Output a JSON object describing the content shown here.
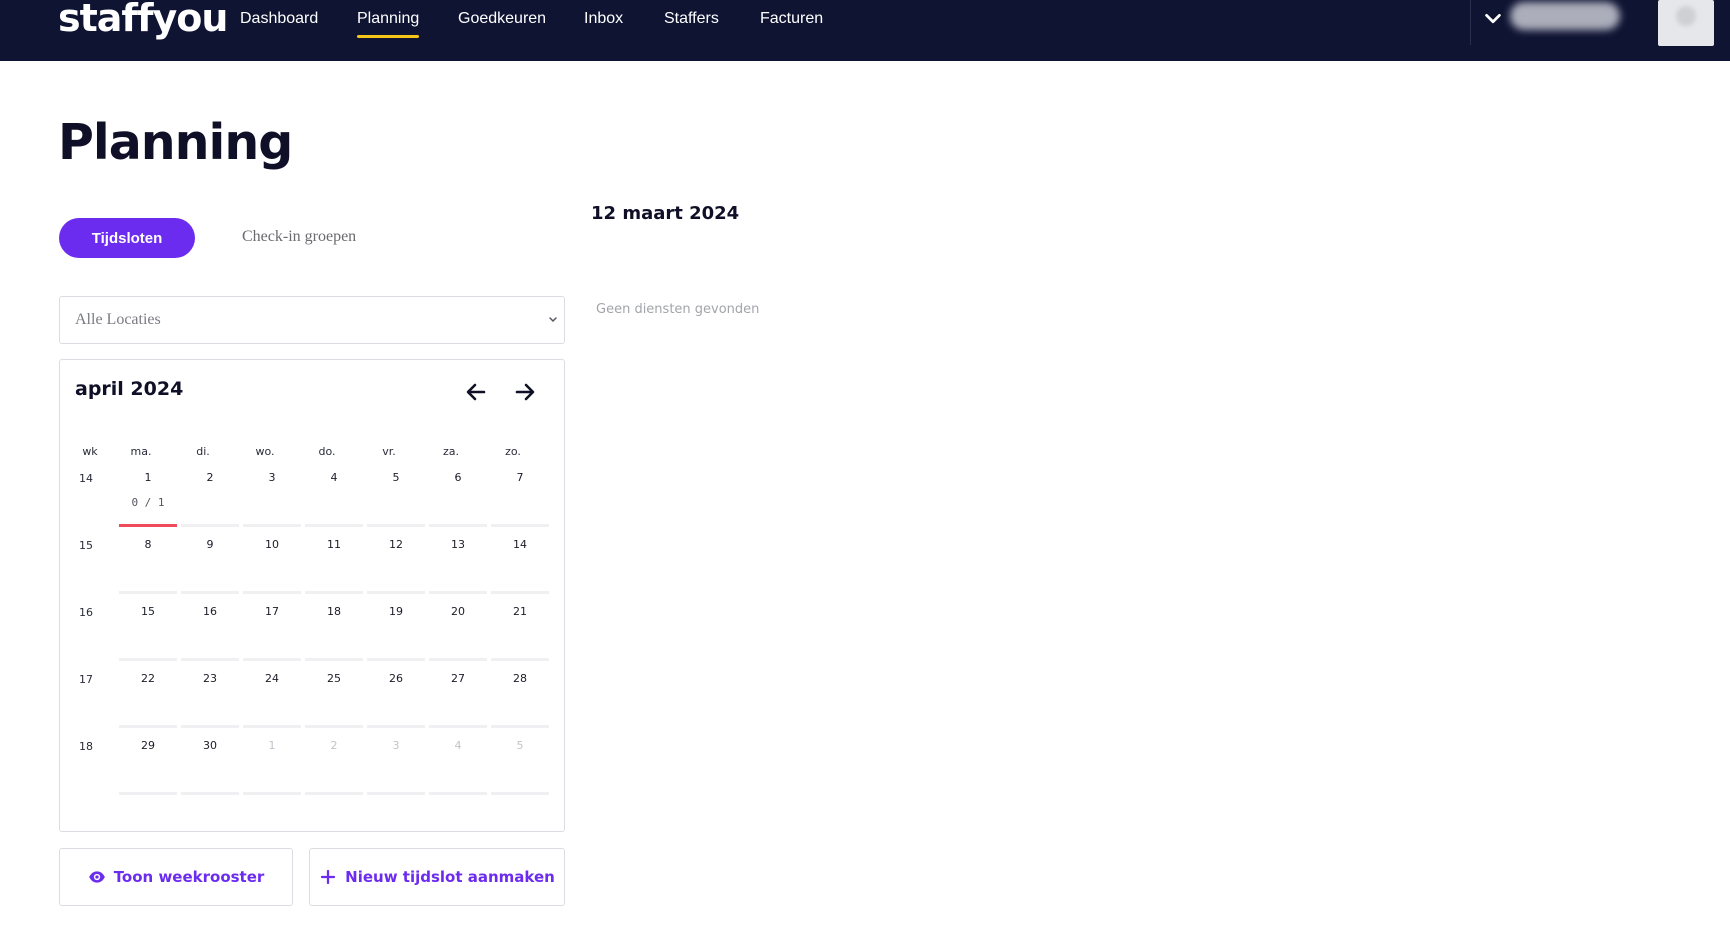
{
  "app": {
    "logo": "staffyou"
  },
  "nav": {
    "items": [
      {
        "label": "Dashboard"
      },
      {
        "label": "Planning",
        "active": true
      },
      {
        "label": "Goedkeuren"
      },
      {
        "label": "Inbox"
      },
      {
        "label": "Staffers"
      },
      {
        "label": "Facturen"
      }
    ]
  },
  "page": {
    "title": "Planning"
  },
  "tabs": {
    "active_label": "Tijdsloten",
    "other_label": "Check-in groepen"
  },
  "location_select": {
    "value": "Alle Locaties"
  },
  "calendar": {
    "month_label": "april 2024",
    "weekdays": [
      "wk",
      "ma.",
      "di.",
      "wo.",
      "do.",
      "vr.",
      "za.",
      "zo."
    ],
    "weeks": [
      {
        "wk": "14",
        "days": [
          "1",
          "2",
          "3",
          "4",
          "5",
          "6",
          "7"
        ]
      },
      {
        "wk": "15",
        "days": [
          "8",
          "9",
          "10",
          "11",
          "12",
          "13",
          "14"
        ]
      },
      {
        "wk": "16",
        "days": [
          "15",
          "16",
          "17",
          "18",
          "19",
          "20",
          "21"
        ]
      },
      {
        "wk": "17",
        "days": [
          "22",
          "23",
          "24",
          "25",
          "26",
          "27",
          "28"
        ]
      },
      {
        "wk": "18",
        "days": [
          "29",
          "30",
          "1",
          "2",
          "3",
          "4",
          "5"
        ]
      }
    ],
    "slot_count": "0 / 1",
    "flag_color": "#ef4b5b"
  },
  "actions": {
    "week_view_label": "Toon weekrooster",
    "new_slot_label": "Nieuw tijdslot aanmaken"
  },
  "detail": {
    "date_heading": "12 maart 2024",
    "empty_text": "Geen diensten gevonden"
  },
  "colors": {
    "nav_bg": "#0f1433",
    "accent": "#6c2cf0",
    "nav_underline": "#f5c518"
  },
  "icons": {
    "user_menu": "chevron-down-icon",
    "prev": "arrow-left-icon",
    "next": "arrow-right-icon",
    "week_view": "eye-icon",
    "new_slot": "plus-icon"
  }
}
